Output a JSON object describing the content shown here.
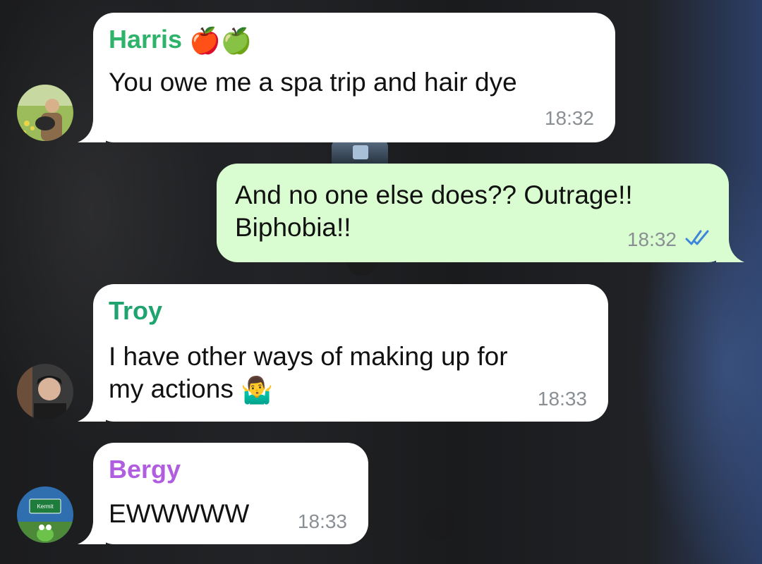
{
  "messages": [
    {
      "sender": "Harris",
      "sender_emoji": "🍎🍏",
      "text": "You owe me a spa trip and hair dye",
      "time": "18:32",
      "direction": "incoming",
      "name_color": "#2fb36b"
    },
    {
      "text_line1": "And no one else does?? Outrage!!",
      "text_line2": "Biphobia!!",
      "time": "18:32",
      "direction": "outgoing",
      "status": "read"
    },
    {
      "sender": "Troy",
      "text_line1": "I have other ways of making up for",
      "text_line2": "my actions",
      "text_emoji": "🤷‍♂️",
      "time": "18:33",
      "direction": "incoming",
      "name_color": "#1fa36f"
    },
    {
      "sender": "Bergy",
      "text": "EWWWWW",
      "time": "18:33",
      "direction": "incoming",
      "name_color": "#b05de0"
    }
  ],
  "avatars": {
    "bergy_sign_text": "Kermit"
  },
  "icons": {
    "read_receipt": "double-check-icon"
  },
  "colors": {
    "outgoing_bubble": "#d9fdd0",
    "incoming_bubble": "#ffffff",
    "read_tick": "#3d86d9"
  }
}
